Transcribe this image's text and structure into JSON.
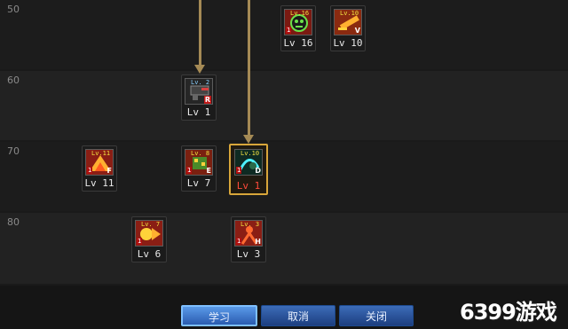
{
  "levels": [
    "50",
    "60",
    "70",
    "80"
  ],
  "skills": [
    {
      "lv_tag": "Lv.16",
      "level": "Lv 16",
      "corner": "",
      "badge": "1",
      "color": "#c83a2a",
      "glow": "#6ce04a"
    },
    {
      "lv_tag": "Lv.10",
      "level": "Lv 10",
      "corner": "V",
      "badge": "",
      "color": "#d0471e",
      "glow": "#ffd23a"
    },
    {
      "lv_tag": "Lv. 2",
      "level": "Lv 1",
      "corner": "R",
      "badge": "",
      "color": "#333",
      "glow": "#d94040"
    },
    {
      "lv_tag": "Lv.11",
      "level": "Lv 11",
      "corner": "F",
      "badge": "1",
      "color": "#c83a2a",
      "glow": "#ffd23a"
    },
    {
      "lv_tag": "Lv. 8",
      "level": "Lv 7",
      "corner": "E",
      "badge": "1",
      "color": "#b03020",
      "glow": "#6ce04a"
    },
    {
      "lv_tag": "Lv.10",
      "level": "Lv 1",
      "corner": "D",
      "badge": "1",
      "color": "#1a3a2a",
      "glow": "#4ef0ff"
    },
    {
      "lv_tag": "Lv. 7",
      "level": "Lv 6",
      "corner": "",
      "badge": "1",
      "color": "#c0302a",
      "glow": "#ffd23a"
    },
    {
      "lv_tag": "Lv. 3",
      "level": "Lv 3",
      "corner": "H",
      "badge": "1",
      "color": "#c0302a",
      "glow": "#ff6a30"
    }
  ],
  "buttons": {
    "learn": "学习",
    "cancel": "取消",
    "close": "关闭"
  },
  "watermark": "6399游戏"
}
